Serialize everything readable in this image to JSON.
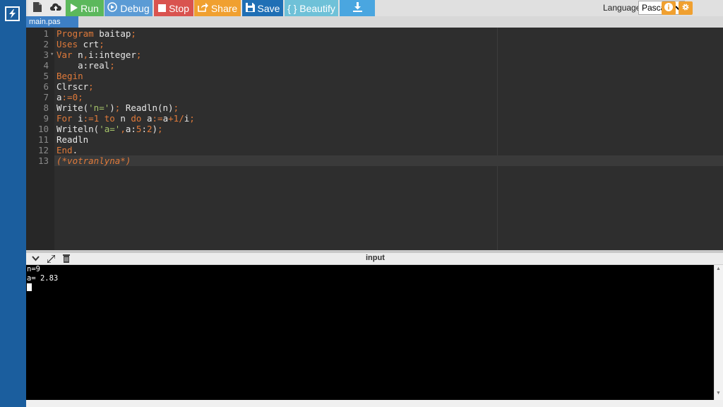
{
  "toolbar": {
    "run": "Run",
    "debug": "Debug",
    "stop": "Stop",
    "share": "Share",
    "save": "Save",
    "beautify": "{ } Beautify",
    "language_label": "Language",
    "language_value": "Pascal",
    "colors": {
      "run": "#5cb85c",
      "debug": "#5b9bd5",
      "stop": "#d9534f",
      "share": "#f0a030",
      "save": "#1f6fb5",
      "beautify": "#6fc1d8",
      "download": "#4aa6e0"
    }
  },
  "tabs": [
    "main.pas"
  ],
  "editor": {
    "line_numbers": [
      "1",
      "2",
      "3",
      "4",
      "5",
      "6",
      "7",
      "8",
      "9",
      "10",
      "11",
      "12",
      "13"
    ]
  },
  "console": {
    "title": "input",
    "lines": [
      "n=9",
      "a= 2.83"
    ]
  }
}
